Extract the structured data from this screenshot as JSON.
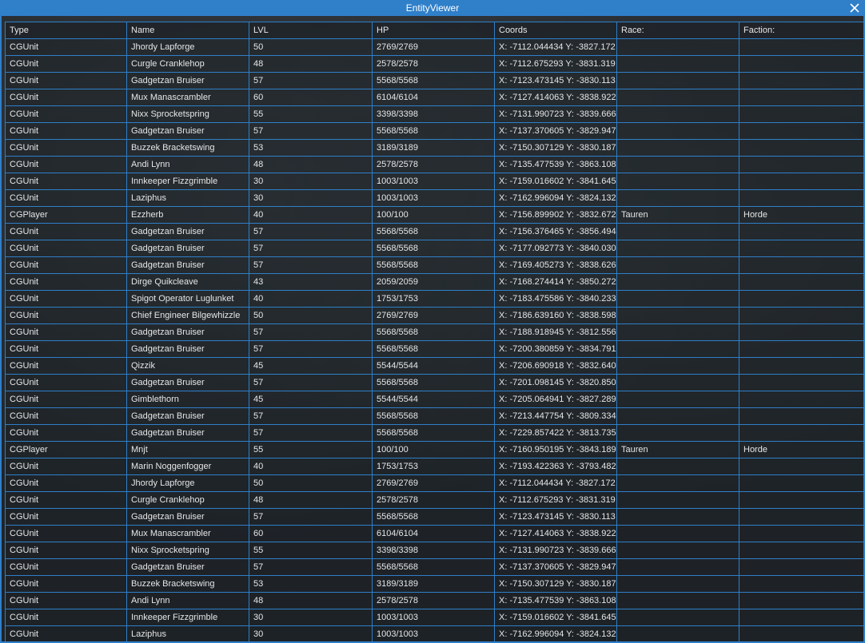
{
  "window": {
    "title": "EntityViewer",
    "accent_color": "#2f7fc9",
    "close_icon": "close-icon"
  },
  "table": {
    "columns": [
      "Type",
      "Name",
      "LVL",
      "HP",
      "Coords",
      "Race:",
      "Faction:"
    ],
    "rows": [
      [
        "CGUnit",
        "Jhordy Lapforge",
        "50",
        "2769/2769",
        "X: -7112.044434 Y: -3827.172",
        "",
        ""
      ],
      [
        "CGUnit",
        "Curgle Cranklehop",
        "48",
        "2578/2578",
        "X: -7112.675293 Y: -3831.319",
        "",
        ""
      ],
      [
        "CGUnit",
        "Gadgetzan Bruiser",
        "57",
        "5568/5568",
        "X: -7123.473145 Y: -3830.113",
        "",
        ""
      ],
      [
        "CGUnit",
        "Mux Manascrambler",
        "60",
        "6104/6104",
        "X: -7127.414063 Y: -3838.922",
        "",
        ""
      ],
      [
        "CGUnit",
        "Nixx Sprocketspring",
        "55",
        "3398/3398",
        "X: -7131.990723 Y: -3839.666",
        "",
        ""
      ],
      [
        "CGUnit",
        "Gadgetzan Bruiser",
        "57",
        "5568/5568",
        "X: -7137.370605 Y: -3829.947",
        "",
        ""
      ],
      [
        "CGUnit",
        "Buzzek Bracketswing",
        "53",
        "3189/3189",
        "X: -7150.307129 Y: -3830.187",
        "",
        ""
      ],
      [
        "CGUnit",
        "Andi Lynn",
        "48",
        "2578/2578",
        "X: -7135.477539 Y: -3863.108",
        "",
        ""
      ],
      [
        "CGUnit",
        "Innkeeper Fizzgrimble",
        "30",
        "1003/1003",
        "X: -7159.016602 Y: -3841.645",
        "",
        ""
      ],
      [
        "CGUnit",
        "Laziphus",
        "30",
        "1003/1003",
        "X: -7162.996094 Y: -3824.132",
        "",
        ""
      ],
      [
        "CGPlayer",
        "Ezzherb",
        "40",
        "100/100",
        "X: -7156.899902 Y: -3832.672",
        "Tauren",
        "Horde"
      ],
      [
        "CGUnit",
        "Gadgetzan Bruiser",
        "57",
        "5568/5568",
        "X: -7156.376465 Y: -3856.494",
        "",
        ""
      ],
      [
        "CGUnit",
        "Gadgetzan Bruiser",
        "57",
        "5568/5568",
        "X: -7177.092773 Y: -3840.030",
        "",
        ""
      ],
      [
        "CGUnit",
        "Gadgetzan Bruiser",
        "57",
        "5568/5568",
        "X: -7169.405273 Y: -3838.626",
        "",
        ""
      ],
      [
        "CGUnit",
        "Dirge Quikcleave",
        "43",
        "2059/2059",
        "X: -7168.274414 Y: -3850.272",
        "",
        ""
      ],
      [
        "CGUnit",
        "Spigot Operator Luglunket",
        "40",
        "1753/1753",
        "X: -7183.475586 Y: -3840.233",
        "",
        ""
      ],
      [
        "CGUnit",
        "Chief Engineer Bilgewhizzle",
        "50",
        "2769/2769",
        "X: -7186.639160 Y: -3838.598",
        "",
        ""
      ],
      [
        "CGUnit",
        "Gadgetzan Bruiser",
        "57",
        "5568/5568",
        "X: -7188.918945 Y: -3812.556",
        "",
        ""
      ],
      [
        "CGUnit",
        "Gadgetzan Bruiser",
        "57",
        "5568/5568",
        "X: -7200.380859 Y: -3834.791",
        "",
        ""
      ],
      [
        "CGUnit",
        "Qizzik",
        "45",
        "5544/5544",
        "X: -7206.690918 Y: -3832.640",
        "",
        ""
      ],
      [
        "CGUnit",
        "Gadgetzan Bruiser",
        "57",
        "5568/5568",
        "X: -7201.098145 Y: -3820.850",
        "",
        ""
      ],
      [
        "CGUnit",
        "Gimblethorn",
        "45",
        "5544/5544",
        "X: -7205.064941 Y: -3827.289",
        "",
        ""
      ],
      [
        "CGUnit",
        "Gadgetzan Bruiser",
        "57",
        "5568/5568",
        "X: -7213.447754 Y: -3809.334",
        "",
        ""
      ],
      [
        "CGUnit",
        "Gadgetzan Bruiser",
        "57",
        "5568/5568",
        "X: -7229.857422 Y: -3813.735",
        "",
        ""
      ],
      [
        "CGPlayer",
        "Mnjt",
        "55",
        "100/100",
        "X: -7160.950195 Y: -3843.189",
        "Tauren",
        "Horde"
      ],
      [
        "CGUnit",
        "Marin Noggenfogger",
        "40",
        "1753/1753",
        "X: -7193.422363 Y: -3793.482",
        "",
        ""
      ],
      [
        "CGUnit",
        "Jhordy Lapforge",
        "50",
        "2769/2769",
        "X: -7112.044434 Y: -3827.172",
        "",
        ""
      ],
      [
        "CGUnit",
        "Curgle Cranklehop",
        "48",
        "2578/2578",
        "X: -7112.675293 Y: -3831.319",
        "",
        ""
      ],
      [
        "CGUnit",
        "Gadgetzan Bruiser",
        "57",
        "5568/5568",
        "X: -7123.473145 Y: -3830.113",
        "",
        ""
      ],
      [
        "CGUnit",
        "Mux Manascrambler",
        "60",
        "6104/6104",
        "X: -7127.414063 Y: -3838.922",
        "",
        ""
      ],
      [
        "CGUnit",
        "Nixx Sprocketspring",
        "55",
        "3398/3398",
        "X: -7131.990723 Y: -3839.666",
        "",
        ""
      ],
      [
        "CGUnit",
        "Gadgetzan Bruiser",
        "57",
        "5568/5568",
        "X: -7137.370605 Y: -3829.947",
        "",
        ""
      ],
      [
        "CGUnit",
        "Buzzek Bracketswing",
        "53",
        "3189/3189",
        "X: -7150.307129 Y: -3830.187",
        "",
        ""
      ],
      [
        "CGUnit",
        "Andi Lynn",
        "48",
        "2578/2578",
        "X: -7135.477539 Y: -3863.108",
        "",
        ""
      ],
      [
        "CGUnit",
        "Innkeeper Fizzgrimble",
        "30",
        "1003/1003",
        "X: -7159.016602 Y: -3841.645",
        "",
        ""
      ],
      [
        "CGUnit",
        "Laziphus",
        "30",
        "1003/1003",
        "X: -7162.996094 Y: -3824.132",
        "",
        ""
      ]
    ]
  }
}
